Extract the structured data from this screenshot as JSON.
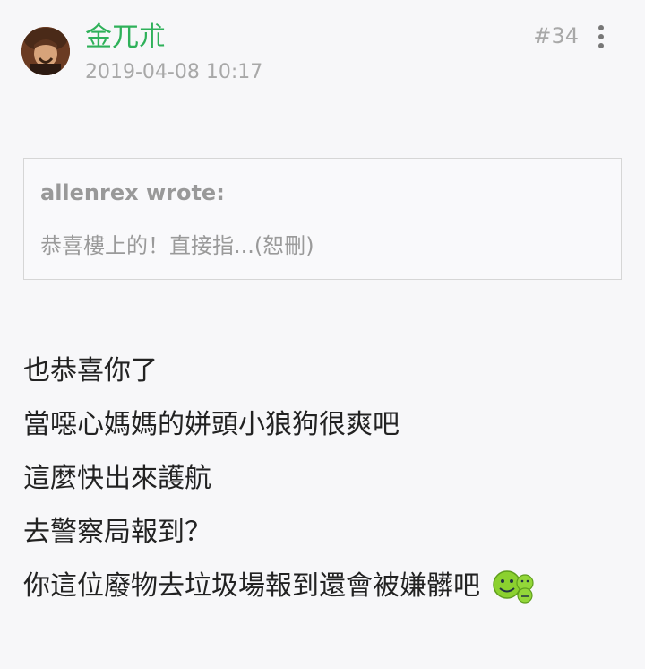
{
  "post": {
    "author": "金兀朮",
    "timestamp": "2019-04-08 10:17",
    "floor": "#34",
    "more_icon": "more-vertical-icon",
    "quote": {
      "author": "allenrex wrote:",
      "text": "恭喜樓上的！直接指...(恕刪)"
    },
    "lines": [
      "也恭喜你了",
      "當噁心媽媽的姘頭小狼狗很爽吧",
      "這麼快出來護航",
      "去警察局報到？",
      "你這位廢物去垃圾場報到還會被嫌髒吧"
    ],
    "emoji_icon": "green-smiley-emoji-icon",
    "colors": {
      "author": "#2fb15a",
      "meta": "#a8a8a8",
      "background": "#f7f7f9"
    }
  }
}
